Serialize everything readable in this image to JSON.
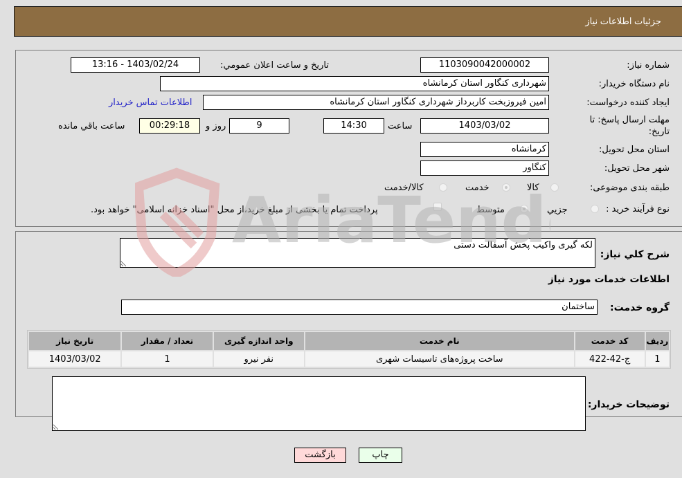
{
  "header": {
    "title": "جزئیات اطلاعات نیاز"
  },
  "form": {
    "need_number": {
      "label": "شماره نیاز:",
      "value": "1103090042000002"
    },
    "announce_datetime": {
      "label": "تاریخ و ساعت اعلان عمومي:",
      "value": "1403/02/24 - 13:16"
    },
    "buyer_org": {
      "label": "نام دستگاه خريدار:",
      "value": "شهرداری کنگاور استان کرمانشاه"
    },
    "requester": {
      "label": "ايجاد کننده درخواست:",
      "value": "امین فیروزبخت کاربرداز شهرداری کنگاور استان کرمانشاه"
    },
    "buyer_contact_link": "اطلاعات تماس خريدار",
    "deadline": {
      "label_line1": "مهلت ارسال پاسخ: تا",
      "label_line2": "تاريخ:",
      "date": "1403/03/02",
      "time_label": "ساعت",
      "time": "14:30",
      "days": "9",
      "days_label": "روز و",
      "remaining": "00:29:18",
      "remaining_label": "ساعت باقي مانده"
    },
    "delivery_province": {
      "label": "استان محل تحويل:",
      "value": "کرمانشاه"
    },
    "delivery_city": {
      "label": "شهر محل تحويل:",
      "value": "کنگاور"
    },
    "category": {
      "label": "طبقه بندی موضوعی:",
      "options": [
        {
          "label": "کالا",
          "checked": false
        },
        {
          "label": "خدمت",
          "checked": true
        },
        {
          "label": "کالا/خدمت",
          "checked": false
        }
      ]
    },
    "purchase_type": {
      "label": "نوع فرآيند خريد :",
      "options": [
        {
          "label": "جزيي",
          "checked": false
        },
        {
          "label": "متوسط",
          "checked": true
        }
      ],
      "treasury_checkbox": {
        "label": "پرداخت تمام يا بخشی از مبلغ خريد،از محل \"اسناد خزانه اسلامی\" خواهد بود.",
        "checked": false
      }
    }
  },
  "details": {
    "description_label": "شرح کلي نياز:",
    "description_value": "لکه گیری واکیب پخش آسفالت دستی",
    "services_title": "اطلاعات خدمات مورد نياز",
    "service_group_label": "گروه خدمت:",
    "service_group_value": "ساختمان",
    "table": {
      "headers": [
        "رديف",
        "کد خدمت",
        "نام خدمت",
        "واحد اندازه گيری",
        "تعداد / مقدار",
        "تاريخ نياز"
      ],
      "rows": [
        [
          "1",
          "ج-42-422",
          "ساخت پروژه‌های تاسیسات شهری",
          "نفر نيرو",
          "1",
          "1403/03/02"
        ]
      ]
    },
    "buyer_notes_label": "توضيحات خريدار:",
    "buyer_notes_value": ""
  },
  "buttons": {
    "print": "چاپ",
    "back": "بازگشت"
  },
  "watermark": {
    "text": "AriaTender.neT"
  }
}
